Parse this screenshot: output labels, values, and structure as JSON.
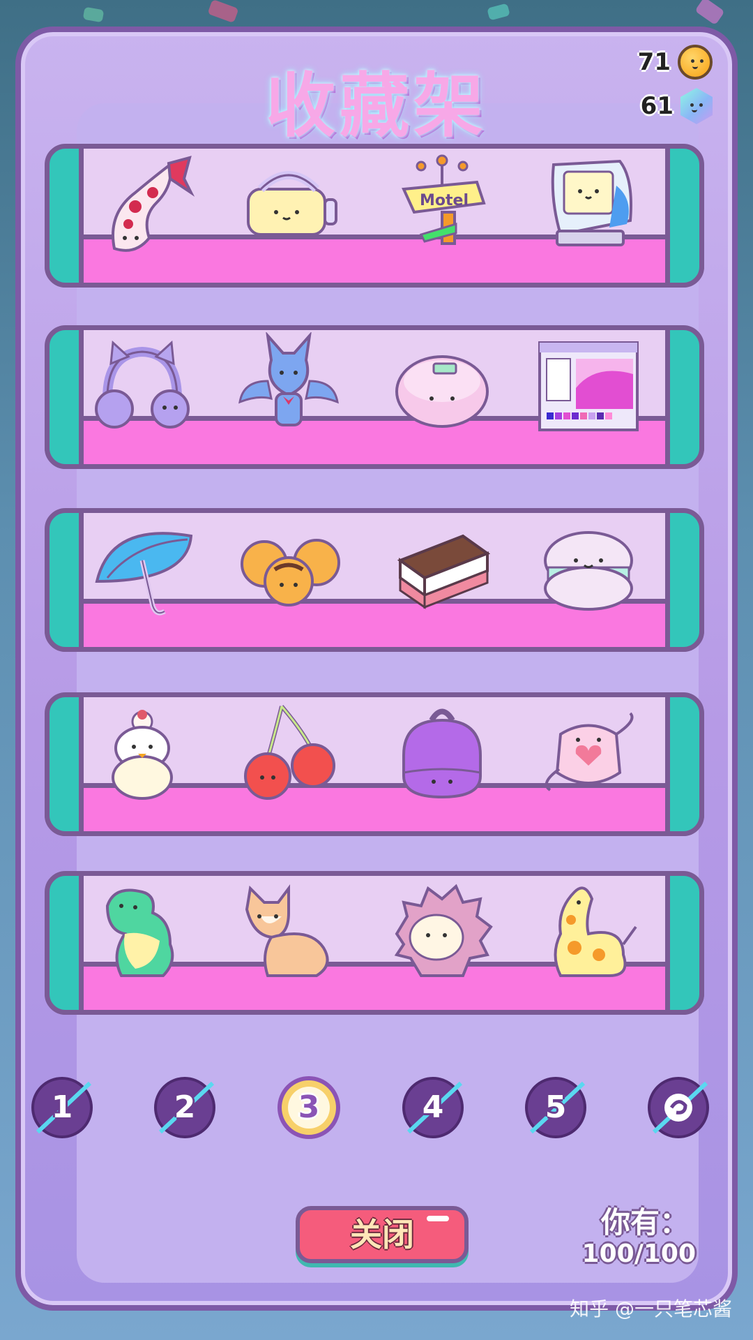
{
  "header": {
    "title": "收藏架"
  },
  "currencies": {
    "coins": {
      "value": "71",
      "icon": "coin-icon"
    },
    "gems": {
      "value": "61",
      "icon": "gem-icon"
    }
  },
  "shelves": [
    {
      "items": [
        "koi-fish",
        "vr-headset",
        "motel-sign",
        "retro-computer"
      ]
    },
    {
      "items": [
        "cat-ear-headphones",
        "bat",
        "cd-player",
        "paint-program-window"
      ]
    },
    {
      "items": [
        "umbrella",
        "takoyaki",
        "ice-cream-sandwich",
        "macaron"
      ]
    },
    {
      "items": [
        "snow-chick",
        "cherries",
        "coin-purse",
        "face-mask"
      ]
    },
    {
      "items": [
        "dinosaur",
        "ferret",
        "hedgehog",
        "giraffe-plush"
      ]
    }
  ],
  "signs": {
    "motel": "Motel"
  },
  "pagination": {
    "pages": [
      "1",
      "2",
      "3",
      "4",
      "5"
    ],
    "active": "3",
    "special_icon": "swirl-icon"
  },
  "footer": {
    "close_label": "关闭",
    "owned_label": "你有：",
    "owned_count": "100/100"
  },
  "watermark": "知乎 @一只笔芯酱",
  "colors": {
    "panel": "#b69ae6",
    "shelf_floor": "#fa78e0",
    "shelf_wall": "#33c6ba",
    "close_button": "#f55c7c",
    "title": "#f7a8e7"
  }
}
